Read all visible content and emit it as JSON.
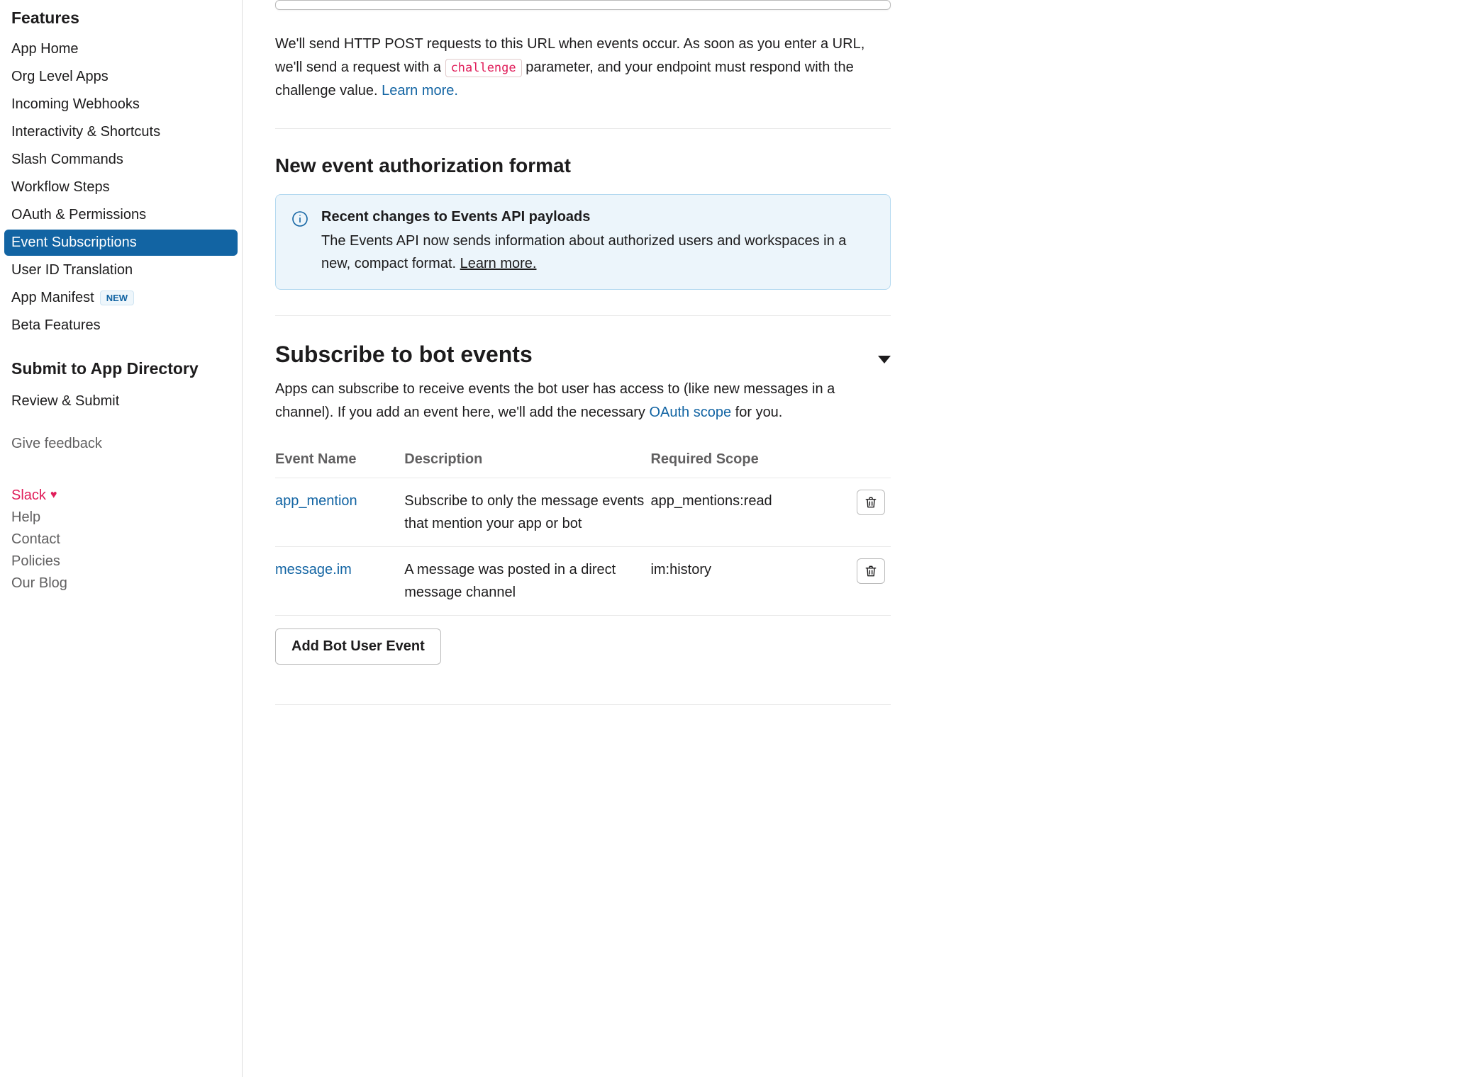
{
  "sidebar": {
    "heading1": "Features",
    "items1": [
      "App Home",
      "Org Level Apps",
      "Incoming Webhooks",
      "Interactivity & Shortcuts",
      "Slash Commands",
      "Workflow Steps",
      "OAuth & Permissions",
      "Event Subscriptions",
      "User ID Translation",
      "App Manifest",
      "Beta Features"
    ],
    "new_badge": "NEW",
    "heading2": "Submit to App Directory",
    "items2": [
      "Review & Submit"
    ],
    "give_feedback": "Give feedback",
    "footer": {
      "slack": "Slack",
      "help": "Help",
      "contact": "Contact",
      "policies": "Policies",
      "our_blog": "Our Blog"
    }
  },
  "request_url": {
    "description_pre": "We'll send HTTP POST requests to this URL when events occur. As soon as you enter a URL, we'll send a request with a ",
    "challenge_code": "challenge",
    "description_post": " parameter, and your endpoint must respond with the challenge value. ",
    "learn_more": "Learn more."
  },
  "auth_format": {
    "title": "New event authorization format",
    "info_title": "Recent changes to Events API payloads",
    "info_body": "The Events API now sends information about authorized users and workspaces in a new, compact format. ",
    "learn_more": "Learn more."
  },
  "bot_events": {
    "title": "Subscribe to bot events",
    "description_pre": "Apps can subscribe to receive events the bot user has access to (like new messages in a channel). If you add an event here, we'll add the necessary ",
    "oauth_scope": "OAuth scope",
    "description_post": " for you.",
    "headers": {
      "event": "Event Name",
      "description": "Description",
      "scope": "Required Scope"
    },
    "rows": [
      {
        "name": "app_mention",
        "description": "Subscribe to only the message events that mention your app or bot",
        "scope": "app_mentions:read"
      },
      {
        "name": "message.im",
        "description": "A message was posted in a direct message channel",
        "scope": "im:history"
      }
    ],
    "add_button": "Add Bot User Event"
  }
}
